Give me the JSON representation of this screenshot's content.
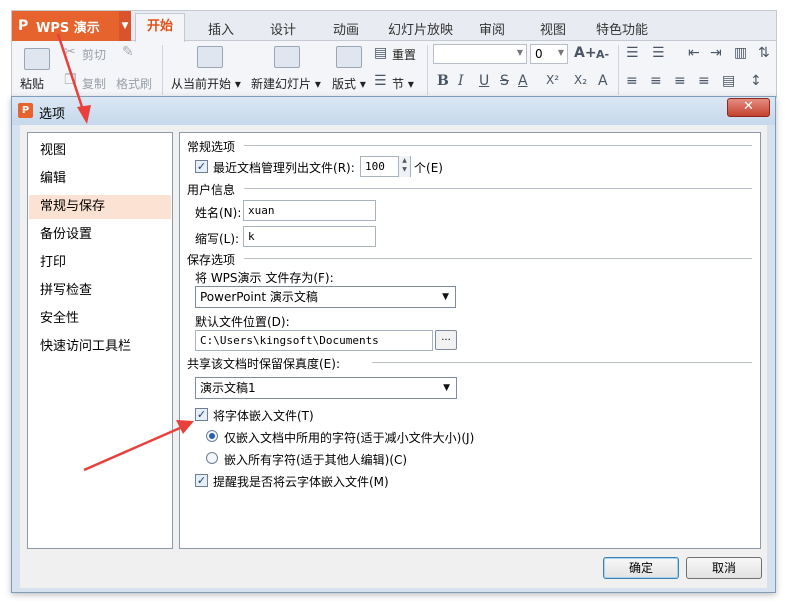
{
  "ribbon": {
    "app_name": "WPS 演示",
    "app_logo": "P",
    "tabs": [
      "开始",
      "插入",
      "设计",
      "动画",
      "幻灯片放映",
      "审阅",
      "视图",
      "特色功能"
    ],
    "active_tab": "开始",
    "paste_label": "粘贴",
    "cut_label": "剪切",
    "copy_label": "复制",
    "format_painter_label": "格式刷",
    "from_current_label": "从当前开始",
    "new_slide_label": "新建幻灯片",
    "layout_label": "版式",
    "reset_label": "重置",
    "section_label": "节",
    "font_size_value": "0",
    "grow_font_icon": "A+",
    "shrink_font_icon": "A-",
    "bold_icon": "B",
    "italic_icon": "I",
    "underline_icon": "U",
    "strike_icon": "S",
    "font_color_icon": "A",
    "superscript_icon": "X²",
    "subscript_icon": "X₂",
    "accent_color": "#e6632e"
  },
  "dialog": {
    "title": "选项",
    "close_icon": "✕",
    "nav_items": [
      "视图",
      "编辑",
      "常规与保存",
      "备份设置",
      "打印",
      "拼写检查",
      "安全性",
      "快速访问工具栏"
    ],
    "selected_nav": "常规与保存",
    "general": {
      "heading": "常规选项",
      "recent_files_label": "最近文档管理列出文件",
      "recent_files_key": "(R):",
      "recent_files_value": "100",
      "recent_files_unit": "个",
      "recent_files_unit_key": "(E)",
      "recent_files_checked": true
    },
    "user": {
      "heading": "用户信息",
      "name_label": "姓名(N):",
      "name_value": "xuan",
      "initials_label": "缩写(L):",
      "initials_value": "k"
    },
    "save": {
      "heading": "保存选项",
      "save_as_label": "将 WPS演示 文件存为(F):",
      "save_as_value": "PowerPoint 演示文稿",
      "default_location_label": "默认文件位置(D):",
      "default_location_value": "C:\\Users\\kingsoft\\Documents",
      "browse_label": "..."
    },
    "fidelity": {
      "heading": "共享该文档时保留保真度(E):",
      "document_value": "演示文稿1",
      "embed_fonts_label": "将字体嵌入文件(T)",
      "embed_fonts_checked": true,
      "embed_used_only_label": "仅嵌入文档中所用的字符(适于减小文件大小)(J)",
      "embed_used_only_selected": true,
      "embed_all_label": "嵌入所有字符(适于其他人编辑)(C)",
      "embed_all_selected": false,
      "cloud_fonts_label": "提醒我是否将云字体嵌入文件(M)",
      "cloud_fonts_checked": true
    },
    "ok_label": "确定",
    "cancel_label": "取消"
  },
  "annotations": {
    "arrow_color": "#e8413c"
  }
}
